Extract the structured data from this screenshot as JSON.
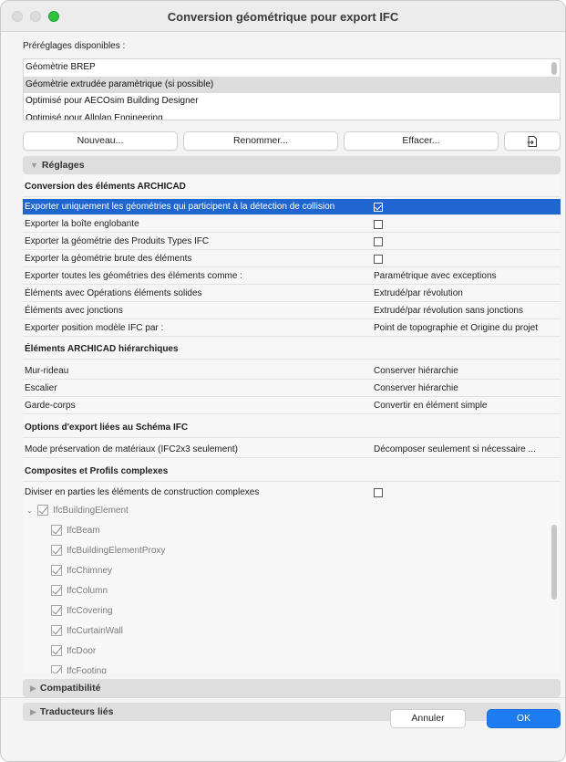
{
  "window": {
    "title": "Conversion géométrique pour export IFC"
  },
  "presets": {
    "label": "Préréglages disponibles :",
    "items": [
      {
        "label": "Géomètrie BREP",
        "selected": false
      },
      {
        "label": "Géomètrie extrudée paramètrique (si possible)",
        "selected": true
      },
      {
        "label": "Optimisé pour AECOsim Building Designer",
        "selected": false
      },
      {
        "label": "Optimisé pour Allplan Engineering",
        "selected": false
      }
    ],
    "buttons": {
      "new": "Nouveau...",
      "rename": "Renommer...",
      "delete": "Effacer...",
      "import_icon": "import-file-icon"
    }
  },
  "settings": {
    "header": "Réglages",
    "groups": {
      "archicad": {
        "title": "Conversion des éléments ARCHICAD",
        "rows": [
          {
            "label": "Exporter uniquement les géométries qui participent à la détection de collision",
            "checked": true,
            "selected": true
          },
          {
            "label": "Exporter la boîte englobante",
            "checked": false
          },
          {
            "label": "Exporter la géométrie des Produits Types IFC",
            "checked": false
          },
          {
            "label": "Exporter la géométrie brute des éléments",
            "checked": false
          },
          {
            "label": "Exporter toutes les géométries des éléments comme :",
            "value": "Paramétrique avec exceptions"
          },
          {
            "label": "Éléments avec Opérations éléments solides",
            "value": "Extrudé/par révolution"
          },
          {
            "label": "Éléments avec jonctions",
            "value": "Extrudé/par révolution sans jonctions"
          },
          {
            "label": "Exporter position modèle IFC par :",
            "value": "Point de topographie et Origine du projet"
          }
        ]
      },
      "hierarchy": {
        "title": "Éléments ARCHICAD hiérarchiques",
        "rows": [
          {
            "label": "Mur-rideau",
            "value": "Conserver hiérarchie"
          },
          {
            "label": "Escalier",
            "value": "Conserver hiérarchie"
          },
          {
            "label": "Garde-corps",
            "value": "Convertir en élément simple"
          }
        ]
      },
      "schema": {
        "title": "Options d'export liées au Schéma IFC",
        "rows": [
          {
            "label": "Mode préservation de matériaux (IFC2x3 seulement)",
            "value": "Décomposer seulement si nécessaire ..."
          }
        ]
      },
      "composites": {
        "title": "Composites et Profils complexes",
        "rows": [
          {
            "label": "Diviser en parties les éléments de construction complexes",
            "checked": false
          }
        ],
        "tree": {
          "root": "IfcBuildingElement",
          "children": [
            "IfcBeam",
            "IfcBuildingElementProxy",
            "IfcChimney",
            "IfcColumn",
            "IfcCovering",
            "IfcCurtainWall",
            "IfcDoor",
            "IfcFooting"
          ]
        }
      }
    }
  },
  "collapsed_sections": {
    "compat": "Compatibilité",
    "translators": "Traducteurs liés"
  },
  "footer": {
    "cancel": "Annuler",
    "ok": "OK"
  },
  "colors": {
    "accent": "#1f66d1",
    "ok_button": "#1d7cf2",
    "zoom_light": "#2ac63c"
  }
}
